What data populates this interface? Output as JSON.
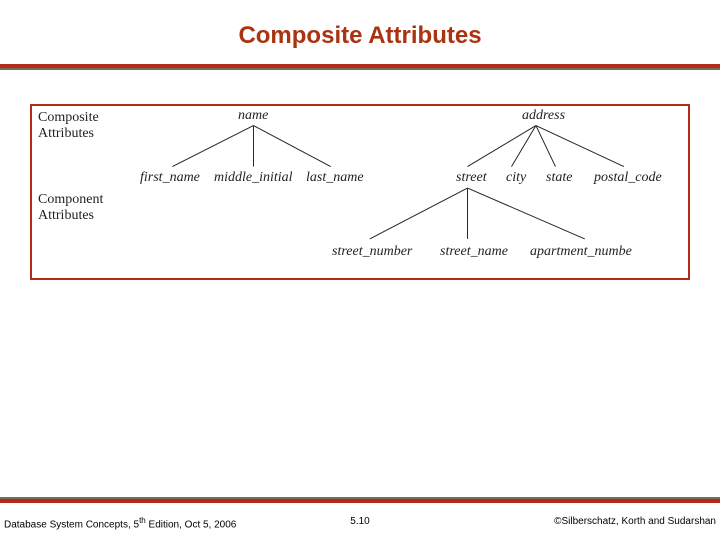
{
  "title": "Composite Attributes",
  "sideLabels": {
    "composite": "Composite\nAttributes",
    "component": "Component\nAttributes"
  },
  "nodes": {
    "name": "name",
    "address": "address",
    "first_name": "first_name",
    "middle_initial": "middle_initial",
    "last_name": "last_name",
    "street": "street",
    "city": "city",
    "state": "state",
    "postal_code": "postal_code",
    "street_number": "street_number",
    "street_name": "street_name",
    "apartment_number": "apartment_numbe"
  },
  "footer": {
    "left_pre": "Database System Concepts, 5",
    "left_sup": "th",
    "left_post": " Edition, Oct 5, 2006",
    "center": "5.10",
    "right": "©Silberschatz, Korth and Sudarshan"
  },
  "chart_data": {
    "type": "diagram",
    "title": "Composite Attributes",
    "trees": [
      {
        "root": "name",
        "children": [
          "first_name",
          "middle_initial",
          "last_name"
        ]
      },
      {
        "root": "address",
        "children": [
          {
            "name": "street",
            "children": [
              "street_number",
              "street_name",
              "apartment_number"
            ]
          },
          "city",
          "state",
          "postal_code"
        ]
      }
    ],
    "rowLabels": [
      "Composite Attributes",
      "Component Attributes"
    ]
  }
}
